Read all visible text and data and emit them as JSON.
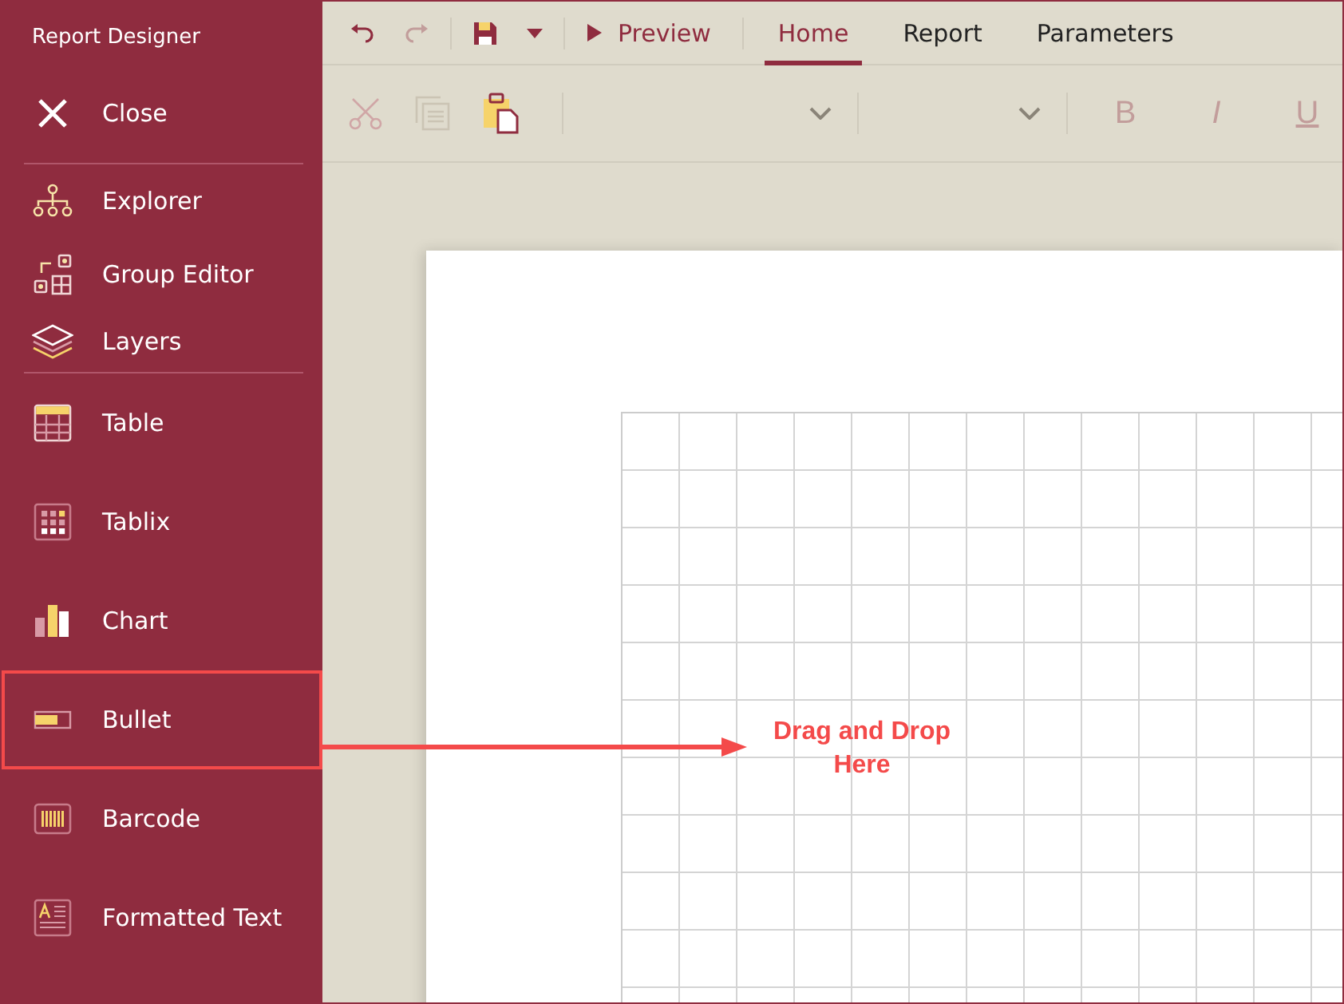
{
  "sidebar": {
    "title": "Report Designer",
    "close": "Close",
    "panels": [
      {
        "kind": "explorer",
        "label": "Explorer"
      },
      {
        "kind": "group-editor",
        "label": "Group Editor"
      },
      {
        "kind": "layers",
        "label": "Layers"
      }
    ],
    "items": [
      {
        "kind": "table",
        "label": "Table",
        "highlighted": false
      },
      {
        "kind": "tablix",
        "label": "Tablix",
        "highlighted": false
      },
      {
        "kind": "chart",
        "label": "Chart",
        "highlighted": false
      },
      {
        "kind": "bullet",
        "label": "Bullet",
        "highlighted": true
      },
      {
        "kind": "barcode",
        "label": "Barcode",
        "highlighted": false
      },
      {
        "kind": "formatted-text",
        "label": "Formatted Text",
        "highlighted": false
      }
    ]
  },
  "toolbar": {
    "redo_disabled": true,
    "preview": "Preview",
    "tabs": [
      {
        "label": "Home",
        "selected": true
      },
      {
        "label": "Report",
        "selected": false
      },
      {
        "label": "Parameters",
        "selected": false
      }
    ],
    "format_buttons": [
      {
        "kind": "bold",
        "label": "B",
        "disabled": true
      },
      {
        "kind": "italic",
        "label": "I",
        "disabled": true
      },
      {
        "kind": "underline",
        "label": "U",
        "disabled": true
      }
    ]
  },
  "callout": {
    "text": "Drag and Drop\nHere"
  }
}
